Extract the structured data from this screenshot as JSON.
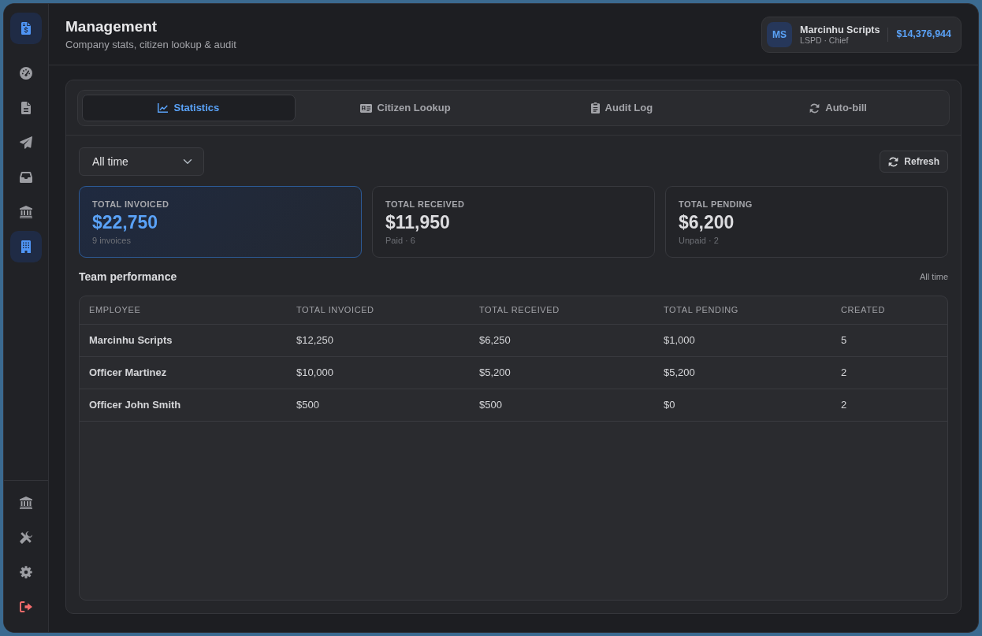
{
  "sidebar": {
    "nav_items": [
      {
        "kind": "dashboard",
        "selected": false
      },
      {
        "kind": "documents",
        "selected": false
      },
      {
        "kind": "send",
        "selected": false
      },
      {
        "kind": "inbox",
        "selected": false
      },
      {
        "kind": "bank",
        "selected": false
      },
      {
        "kind": "company",
        "selected": true
      }
    ],
    "bottom_items": [
      {
        "kind": "bank",
        "selected": false
      },
      {
        "kind": "tools",
        "selected": false
      },
      {
        "kind": "settings",
        "selected": false
      },
      {
        "kind": "logout",
        "selected": false
      }
    ]
  },
  "header": {
    "title": "Management",
    "subtitle": "Company stats, citizen lookup & audit"
  },
  "user": {
    "initials": "MS",
    "name": "Marcinhu Scripts",
    "role": "LSPD · Chief",
    "balance": "$14,376,944"
  },
  "tabs": [
    {
      "label": "Statistics",
      "kind": "chart",
      "selected": true
    },
    {
      "label": "Citizen Lookup",
      "kind": "id-card",
      "selected": false
    },
    {
      "label": "Audit Log",
      "kind": "clipboard",
      "selected": false
    },
    {
      "label": "Auto-bill",
      "kind": "sync",
      "selected": false
    }
  ],
  "filter": {
    "period": "All time"
  },
  "refresh_button": {
    "label": "Refresh"
  },
  "stats": [
    {
      "label": "TOTAL INVOICED",
      "value": "$22,750",
      "note": "9 invoices",
      "highlighted": true
    },
    {
      "label": "TOTAL RECEIVED",
      "value": "$11,950",
      "note": "Paid · 6",
      "highlighted": false
    },
    {
      "label": "TOTAL PENDING",
      "value": "$6,200",
      "note": "Unpaid · 2",
      "highlighted": false
    }
  ],
  "team_performance": {
    "title": "Team performance",
    "period": "All time",
    "columns": [
      "EMPLOYEE",
      "TOTAL INVOICED",
      "TOTAL RECEIVED",
      "TOTAL PENDING",
      "CREATED"
    ],
    "rows": [
      [
        "Marcinhu Scripts",
        "$12,250",
        "$6,250",
        "$1,000",
        "5"
      ],
      [
        "Officer Martinez",
        "$10,000",
        "$5,200",
        "$5,200",
        "2"
      ],
      [
        "Officer John Smith",
        "$500",
        "$500",
        "$0",
        "2"
      ]
    ]
  }
}
